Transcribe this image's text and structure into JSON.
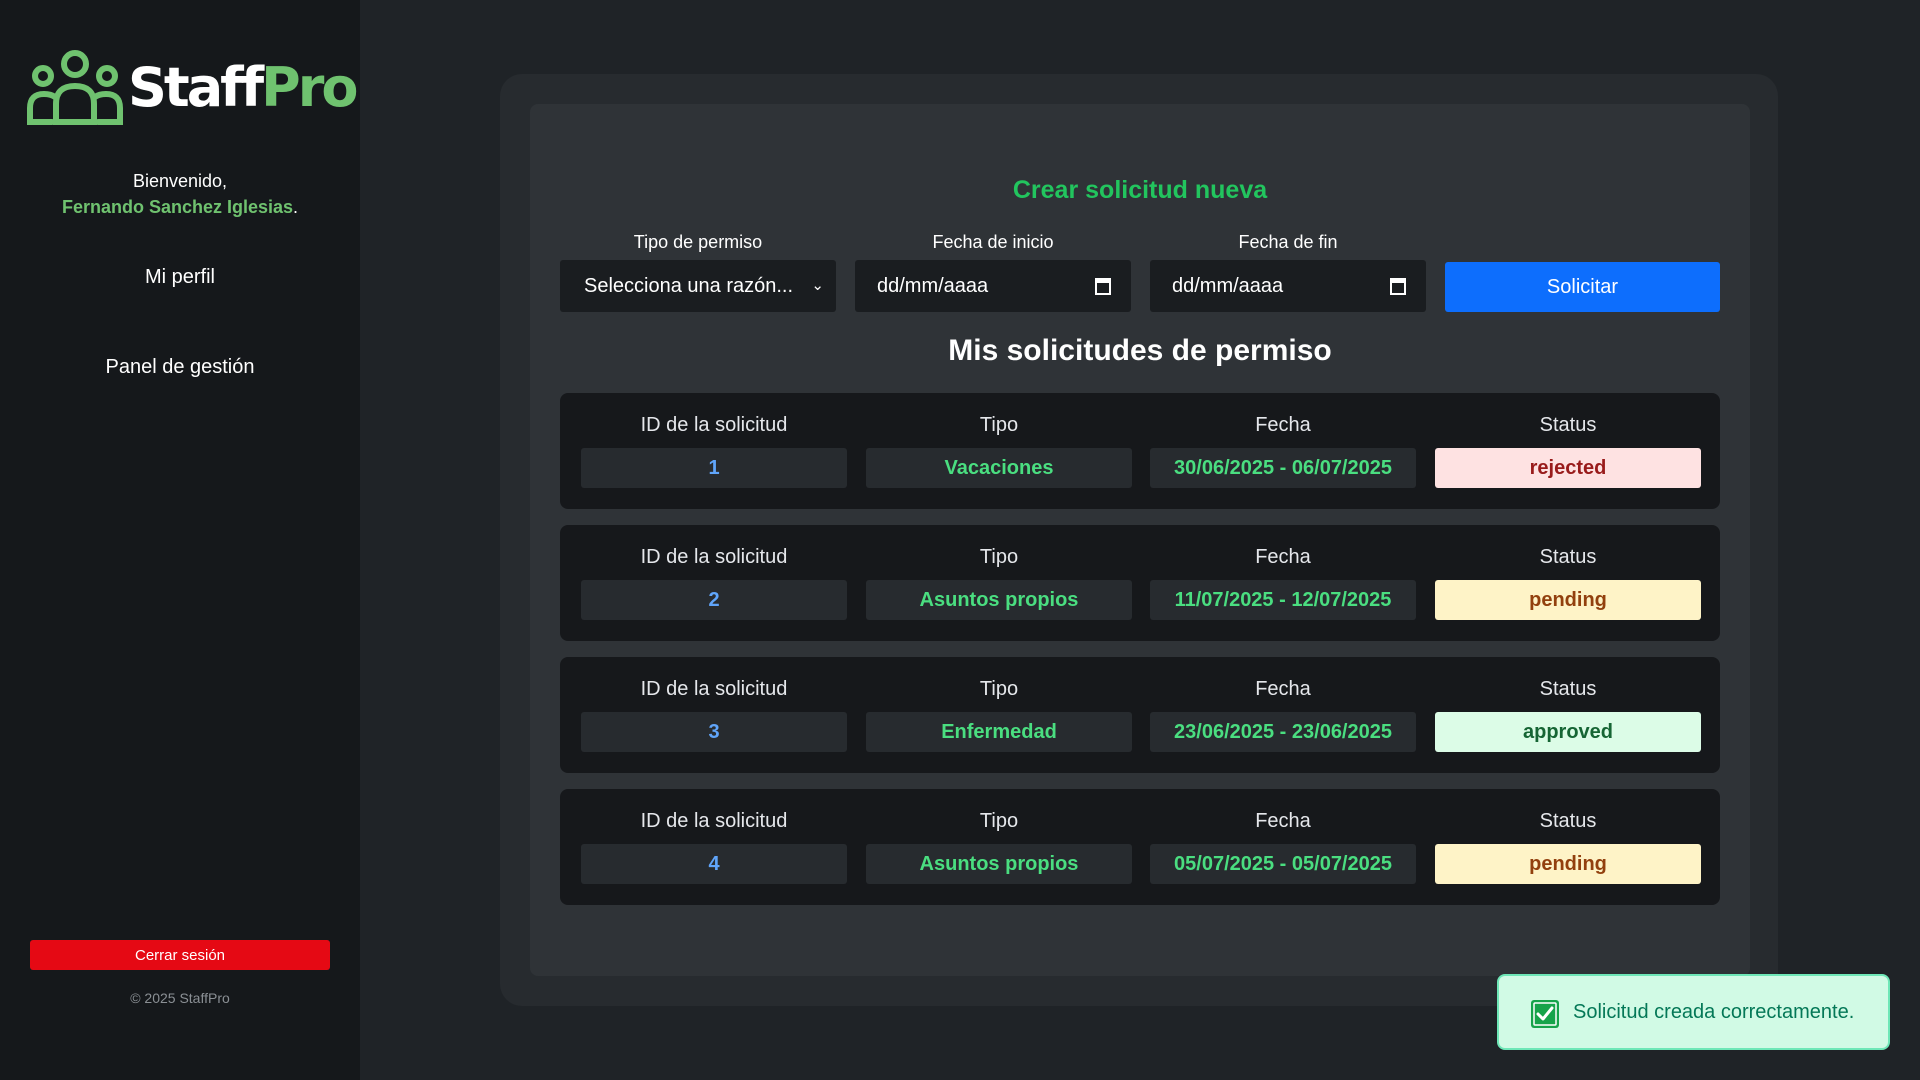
{
  "sidebar": {
    "logo": {
      "part1": "Staff",
      "part2": "Pro"
    },
    "welcome_label": "Bienvenido,",
    "user_name": "Fernando Sanchez Iglesias",
    "user_suffix": ".",
    "nav": [
      {
        "label": "Mi perfil"
      },
      {
        "label": "Panel de gestión"
      }
    ],
    "logout_label": "Cerrar sesión",
    "copyright": "© 2025 StaffPro"
  },
  "form": {
    "title": "Crear solicitud nueva",
    "fields": [
      {
        "label": "Tipo de permiso",
        "value": "Selecciona una razón..."
      },
      {
        "label": "Fecha de inicio",
        "value": "dd/mm/aaaa"
      },
      {
        "label": "Fecha de fin",
        "value": "dd/mm/aaaa"
      }
    ],
    "submit_label": "Solicitar"
  },
  "list": {
    "title": "Mis solicitudes de permiso",
    "columns": [
      "ID de la solicitud",
      "Tipo",
      "Fecha",
      "Status"
    ],
    "rows": [
      {
        "id": "1",
        "type": "Vacaciones",
        "date": "30/06/2025 - 06/07/2025",
        "status": "rejected"
      },
      {
        "id": "2",
        "type": "Asuntos propios",
        "date": "11/07/2025 - 12/07/2025",
        "status": "pending"
      },
      {
        "id": "3",
        "type": "Enfermedad",
        "date": "23/06/2025 - 23/06/2025",
        "status": "approved"
      },
      {
        "id": "4",
        "type": "Asuntos propios",
        "date": "05/07/2025 - 05/07/2025",
        "status": "pending"
      }
    ]
  },
  "toast": {
    "message": "Solicitud creada correctamente.",
    "icon": "check-icon"
  },
  "colors": {
    "accent_green": "#6fc26f",
    "primary_blue": "#0d6efd",
    "danger_red": "#e50914"
  }
}
